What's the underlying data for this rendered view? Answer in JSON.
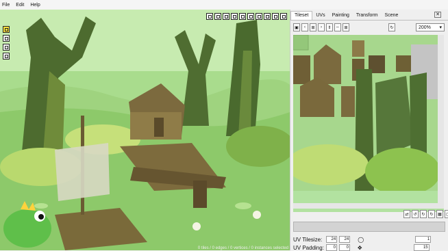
{
  "menu": [
    "File",
    "Edit",
    "Help"
  ],
  "viewport": {
    "status": "0 tiles / 0 edges / 0 vertices / 0 instances selected",
    "toolbar_icons": [
      "box-icon",
      "boxes-icon",
      "transform-icon",
      "move-icon",
      "rotate-icon",
      "scale-icon",
      "mirror-icon",
      "undo-icon",
      "redo-icon",
      "menu-icon"
    ],
    "left_tools": [
      "select-tile-icon",
      "select-edge-icon",
      "select-vertex-icon",
      "select-instance-icon"
    ]
  },
  "panel": {
    "tabs": [
      "Tileset",
      "UVs",
      "Painting",
      "Transform",
      "Scene"
    ],
    "active_tab": "Tileset",
    "close_label": "✕",
    "zoom": "200%",
    "toolbar_glyphs": [
      "▣",
      "‹",
      "›",
      "⊞",
      "⇕",
      "⇔",
      "⊞"
    ]
  },
  "uv": {
    "tilesize_label": "UV Tilesize:",
    "tilesize_w": "24",
    "tilesize_h": "24",
    "padding_label": "UV Padding:",
    "padding_x": "0",
    "padding_y": "0",
    "right_top": "1",
    "right_bottom": "15"
  },
  "colors": {
    "accent": "#ffe23c",
    "grass": "#a8d98e",
    "tree_dark": "#4a6a2e"
  }
}
